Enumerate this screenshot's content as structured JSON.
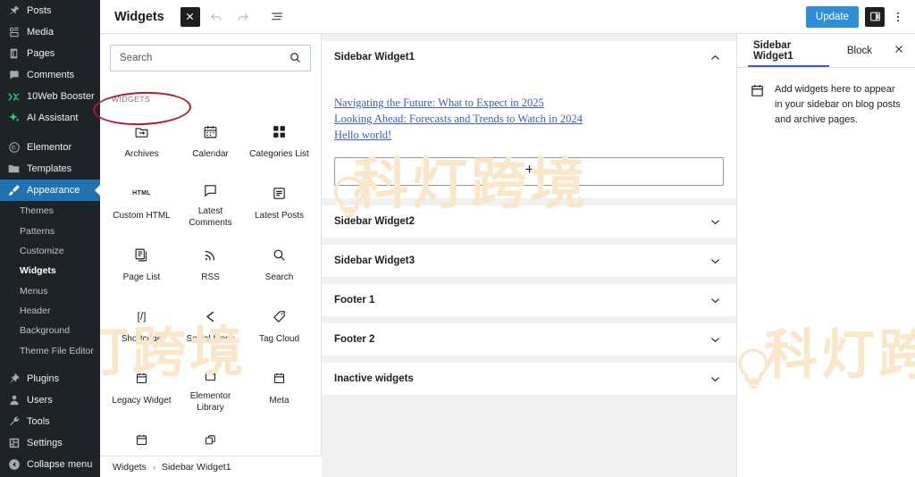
{
  "admin_menu": {
    "items": [
      {
        "label": "Posts",
        "icon": "pin-icon",
        "name": "sidebar-item-posts"
      },
      {
        "label": "Media",
        "icon": "media-icon",
        "name": "sidebar-item-media"
      },
      {
        "label": "Pages",
        "icon": "page-icon",
        "name": "sidebar-item-pages"
      },
      {
        "label": "Comments",
        "icon": "comment-icon",
        "name": "sidebar-item-comments"
      },
      {
        "label": "10Web Booster",
        "icon": "booster-icon",
        "name": "sidebar-item-10web-booster"
      },
      {
        "label": "AI Assistant",
        "icon": "sparkle-icon",
        "name": "sidebar-item-ai-assistant"
      },
      {
        "label": "Elementor",
        "icon": "elementor-icon",
        "name": "sidebar-item-elementor"
      },
      {
        "label": "Templates",
        "icon": "folder-icon",
        "name": "sidebar-item-templates"
      },
      {
        "label": "Appearance",
        "icon": "brush-icon",
        "name": "sidebar-item-appearance",
        "active": true
      }
    ],
    "appearance_submenu": [
      {
        "label": "Themes",
        "name": "submenu-item-themes"
      },
      {
        "label": "Patterns",
        "name": "submenu-item-patterns"
      },
      {
        "label": "Customize",
        "name": "submenu-item-customize"
      },
      {
        "label": "Widgets",
        "name": "submenu-item-widgets",
        "current": true
      },
      {
        "label": "Menus",
        "name": "submenu-item-menus"
      },
      {
        "label": "Header",
        "name": "submenu-item-header"
      },
      {
        "label": "Background",
        "name": "submenu-item-background"
      },
      {
        "label": "Theme File Editor",
        "name": "submenu-item-theme-file-editor"
      }
    ],
    "bottom_items": [
      {
        "label": "Plugins",
        "icon": "plug-icon",
        "name": "sidebar-item-plugins"
      },
      {
        "label": "Users",
        "icon": "user-icon",
        "name": "sidebar-item-users"
      },
      {
        "label": "Tools",
        "icon": "wrench-icon",
        "name": "sidebar-item-tools"
      },
      {
        "label": "Settings",
        "icon": "sliders-icon",
        "name": "sidebar-item-settings"
      },
      {
        "label": "Collapse menu",
        "icon": "collapse-icon",
        "name": "sidebar-item-collapse-menu"
      }
    ]
  },
  "header": {
    "title": "Widgets",
    "toggle_inserter_icon": "close-x-icon",
    "undo_icon": "undo-arrow-icon",
    "redo_icon": "redo-arrow-icon",
    "list_view_icon": "list-view-icon",
    "update_label": "Update",
    "sidebar_toggle_icon": "settings-panel-icon",
    "options_icon": "vertical-dots-icon"
  },
  "inserter": {
    "search_placeholder": "Search",
    "search_value": "",
    "search_icon": "search-icon",
    "category_label": "WIDGETS",
    "widgets": [
      {
        "label": "Archives",
        "icon": "archive-box-icon"
      },
      {
        "label": "Calendar",
        "icon": "calendar-icon"
      },
      {
        "label": "Categories List",
        "icon": "grid-four-icon"
      },
      {
        "label": "Custom HTML",
        "icon": "html-icon"
      },
      {
        "label": "Latest Comments",
        "icon": "speech-bubble-icon"
      },
      {
        "label": "Latest Posts",
        "icon": "post-list-icon"
      },
      {
        "label": "Page List",
        "icon": "pages-stack-icon"
      },
      {
        "label": "RSS",
        "icon": "rss-icon"
      },
      {
        "label": "Search",
        "icon": "search-icon"
      },
      {
        "label": "Shortcode",
        "icon": "shortcode-icon"
      },
      {
        "label": "Social Icons",
        "icon": "share-icon"
      },
      {
        "label": "Tag Cloud",
        "icon": "tag-icon"
      },
      {
        "label": "Legacy Widget",
        "icon": "widget-icon"
      },
      {
        "label": "Elementor Library",
        "icon": "widget-icon"
      },
      {
        "label": "Meta",
        "icon": "widget-icon"
      },
      {
        "label": "",
        "icon": "widget-icon"
      },
      {
        "label": "",
        "icon": "duplicate-icon"
      }
    ],
    "breadcrumb": {
      "root": "Widgets",
      "separator": "›",
      "current": "Sidebar Widget1"
    }
  },
  "canvas": {
    "areas": [
      {
        "title": "Sidebar Widget1",
        "expanded": true,
        "chevron_icon": "chevron-up-icon",
        "links": [
          "Navigating the Future: What to Expect in 2025",
          "Looking Ahead: Forecasts and Trends to Watch in 2024",
          "Hello world!"
        ],
        "appender_icon": "plus-icon"
      },
      {
        "title": "Sidebar Widget2",
        "expanded": false,
        "chevron_icon": "chevron-down-icon"
      },
      {
        "title": "Sidebar Widget3",
        "expanded": false,
        "chevron_icon": "chevron-down-icon"
      },
      {
        "title": "Footer 1",
        "expanded": false,
        "chevron_icon": "chevron-down-icon"
      },
      {
        "title": "Footer 2",
        "expanded": false,
        "chevron_icon": "chevron-down-icon"
      },
      {
        "title": "Inactive widgets",
        "expanded": false,
        "chevron_icon": "chevron-down-icon"
      }
    ]
  },
  "settings": {
    "tabs": [
      {
        "label": "Sidebar Widget1",
        "active": true
      },
      {
        "label": "Block",
        "active": false
      }
    ],
    "close_icon": "close-icon",
    "panel_icon": "widget-area-icon",
    "description": "Add widgets here to appear in your sidebar on blog posts and archive pages."
  },
  "annotation": {
    "shape": "ellipse",
    "color": "#a8222c",
    "target": "WIDGETS"
  },
  "watermarks": {
    "text": "科灯跨境",
    "color": "#fae7ca"
  },
  "colors": {
    "admin_bg": "#1d2327",
    "admin_active": "#2271b1",
    "update_button": "#2e8fd6",
    "link": "#3858e9",
    "tab_underline": "#3858e9",
    "canvas_bg": "#f0f0f0"
  }
}
